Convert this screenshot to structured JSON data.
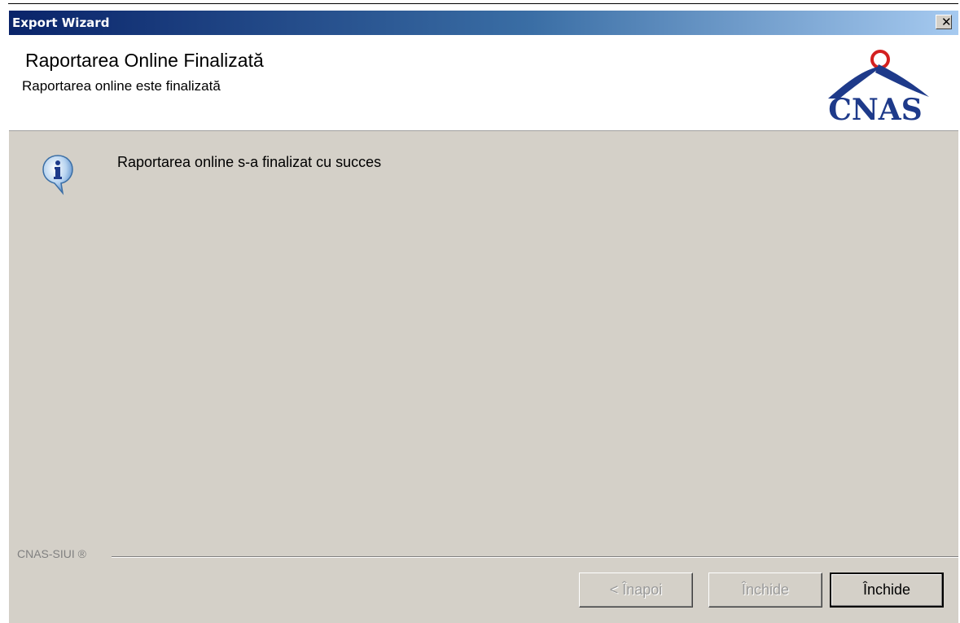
{
  "window": {
    "title": "Export Wizard",
    "close_glyph": "✕"
  },
  "header": {
    "title": "Raportarea Online Finalizată",
    "subtitle": "Raportarea online este finalizată",
    "logo_text": "CNAS",
    "logo_icon": "cnas-house-logo-icon"
  },
  "content": {
    "message": "Raportarea online s-a finalizat cu succes",
    "icon": "info-icon"
  },
  "footer": {
    "label": "CNAS-SIUI ®",
    "buttons": {
      "back": "< Înapoi",
      "next_disabled": "Închide",
      "close": "Închide"
    }
  },
  "colors": {
    "titlebar_start": "#0a246a",
    "titlebar_end": "#a6caf0",
    "dialog_bg": "#d4d0c8",
    "logo_blue": "#1e3a8a",
    "logo_red": "#d32020"
  }
}
